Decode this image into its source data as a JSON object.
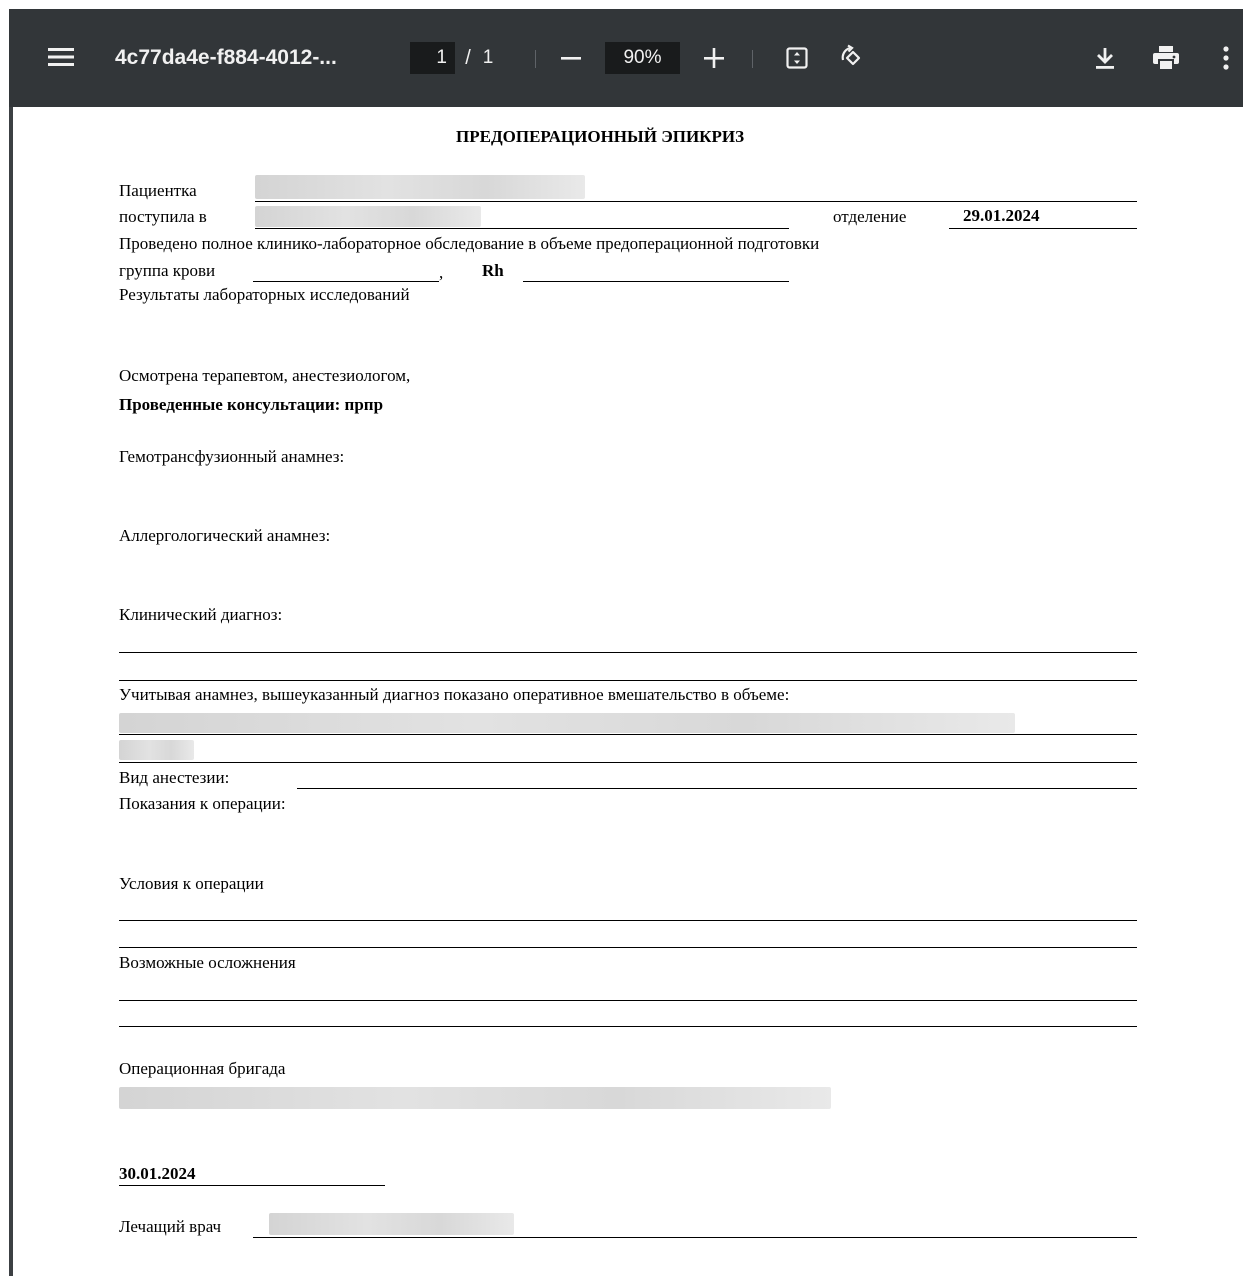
{
  "viewer": {
    "title": "4c77da4e-f884-4012-...",
    "current_page": "1",
    "page_separator": "/",
    "total_pages": "1",
    "zoom": "90%",
    "icons": {
      "menu": "hamburger-menu-icon",
      "zoom_out": "minus-icon",
      "zoom_in": "plus-icon",
      "fit": "fit-to-page-icon",
      "rotate": "rotate-icon",
      "download": "download-icon",
      "print": "print-icon",
      "more": "more-vertical-icon"
    },
    "colors": {
      "toolbar_bg": "#323639",
      "input_bg": "#191b1c",
      "icon": "#f1f1f1"
    }
  },
  "document": {
    "heading": "ПРЕДОПЕРАЦИОННЫЙ ЭПИКРИЗ",
    "patient_label": "Пациентка",
    "admitted_label": "поступила в",
    "department_label": "отделение",
    "admission_date": "29.01.2024",
    "exam_text": "Проведено полное клинико-лабораторное обследование в объеме предоперационной подготовки",
    "blood_group_label": "группа крови",
    "comma": ",",
    "rh_label": "Rh",
    "lab_results_label": "Результаты лабораторных исследований",
    "examined_text": "Осмотрена терапевтом, анестезиологом,",
    "consultations_text": "Проведенные консультации: прпр",
    "transfusion_label": "Гемотрансфузионный анамнез:",
    "allergy_label": "Аллергологический анамнез:",
    "diagnosis_label": "Клинический диагноз:",
    "indication_text": "Учитывая анамнез, вышеуказанный диагноз показано оперативное вмешательство в объеме:",
    "anesthesia_label": "Вид анестезии:",
    "indications_label": "Показания к операции:",
    "conditions_label": "Условия к операции",
    "complications_label": "Возможные осложнения",
    "team_label": "Операционная бригада",
    "sign_date": "30.01.2024",
    "doctor_label": "Лечащий врач"
  }
}
